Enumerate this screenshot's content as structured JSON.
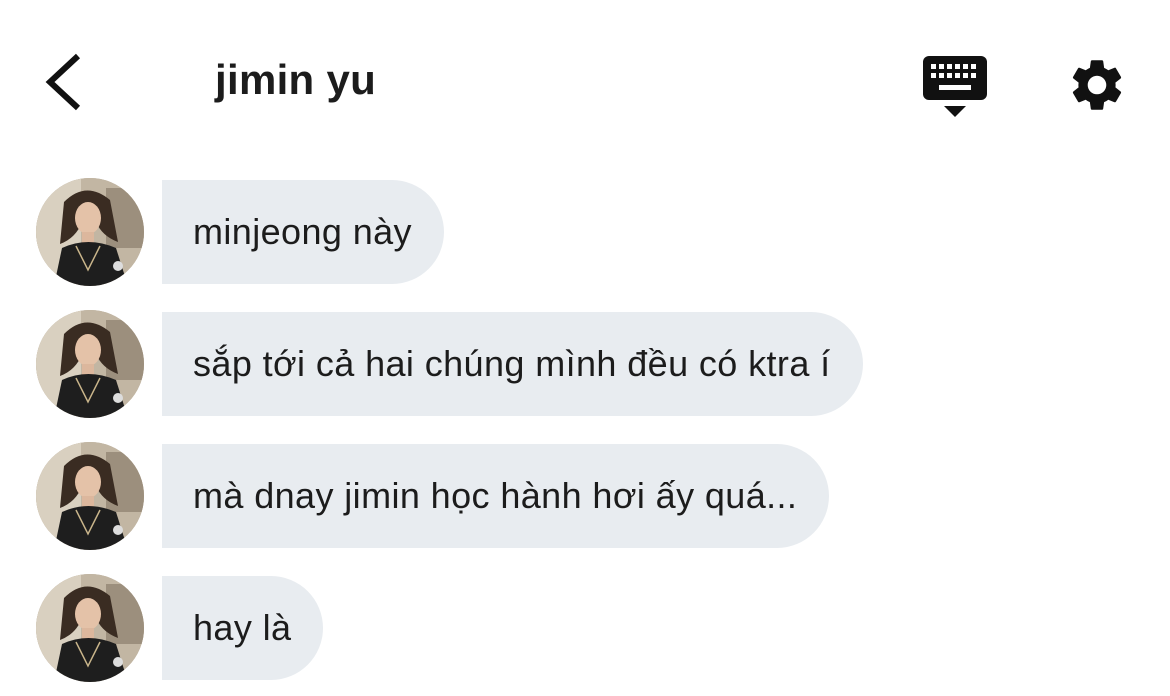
{
  "header": {
    "title": "jimin yu"
  },
  "messages": [
    {
      "text": "minjeong này"
    },
    {
      "text": "sắp tới cả hai chúng mình đều có ktra í"
    },
    {
      "text": "mà dnay jimin học hành hơi ấy quá..."
    },
    {
      "text": "hay là"
    }
  ],
  "icons": {
    "back": "chevron-left-icon",
    "keyboard": "keyboard-hide-icon",
    "settings": "gear-icon"
  },
  "colors": {
    "bubble": "#e8ecf0",
    "text": "#1c1c1c",
    "background": "#ffffff"
  }
}
